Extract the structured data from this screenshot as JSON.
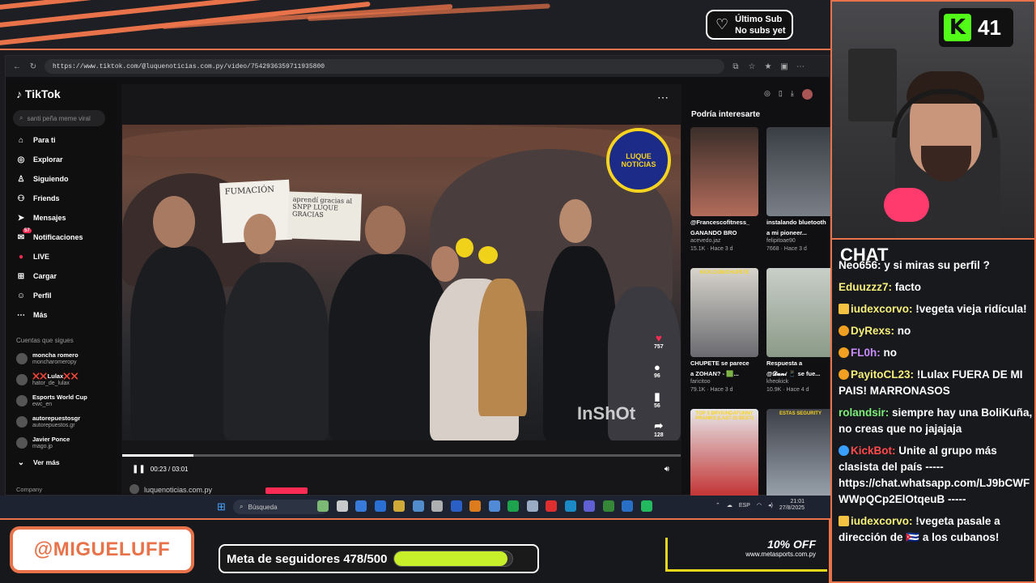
{
  "colors": {
    "accent": "#e8734a",
    "kick_green": "#53fc18",
    "goal_fill": "#c8f02a",
    "tiktok_red": "#fe2c55"
  },
  "overlay": {
    "sub_title": "Último Sub",
    "sub_value": "No subs yet",
    "kick_count": "41",
    "handle": "@MIGUELUFF",
    "goal_text": "Meta de seguidores 478/500",
    "goal_progress": 0.956,
    "ad_headline": "10% OFF",
    "ad_site": "www.metasports.com.py"
  },
  "browser": {
    "url": "https://www.tiktok.com/@luquenoticias.com.py/video/7542936359711935800"
  },
  "tiktok": {
    "logo": "TikTok",
    "search_placeholder": "santi peña meme viral",
    "nav": [
      {
        "label": "Para ti",
        "icon": "home-icon"
      },
      {
        "label": "Explorar",
        "icon": "compass-icon"
      },
      {
        "label": "Siguiendo",
        "icon": "following-icon"
      },
      {
        "label": "Friends",
        "icon": "friends-icon"
      },
      {
        "label": "Mensajes",
        "icon": "send-icon"
      },
      {
        "label": "Notificaciones",
        "icon": "inbox-icon",
        "badge": "57"
      },
      {
        "label": "LIVE",
        "icon": "live-icon"
      },
      {
        "label": "Cargar",
        "icon": "plus-icon"
      },
      {
        "label": "Perfil",
        "icon": "profile-icon"
      },
      {
        "label": "Más",
        "icon": "more-icon"
      }
    ],
    "following_title": "Cuentas que sigues",
    "following": [
      {
        "name": "moncha romero",
        "handle": "moncharomeropy"
      },
      {
        "name": "❌❌Lulax❌❌",
        "handle": "hator_de_lulax"
      },
      {
        "name": "Esports World Cup",
        "handle": "ewc_en"
      },
      {
        "name": "autorepuestosgr",
        "handle": "autorepuestos.gr"
      },
      {
        "name": "Javier Ponce",
        "handle": "mago.jp"
      }
    ],
    "see_more": "Ver más",
    "company": "Company",
    "video": {
      "logo_text": "LUQUE NOTICIAS",
      "watermark": "InShOt",
      "sign_text": "FUMACIÓN",
      "sign2_text": "aprendí gracias al SNPP LUQUE GRACIAS",
      "time": "00:23 / 03:01",
      "progress": 0.127,
      "channel": "luquenoticias.com.py"
    },
    "actions": [
      {
        "icon": "heart-icon",
        "count": "757"
      },
      {
        "icon": "comment-icon",
        "count": "96"
      },
      {
        "icon": "bookmark-icon",
        "count": "56"
      },
      {
        "icon": "share-icon",
        "count": "128"
      }
    ],
    "reco_title": "Podría interesarte",
    "reco": [
      {
        "caption": "@Francescofitness_",
        "caption2": "GANANDO BRO",
        "author": "acevedo.jaz",
        "stats": "15.1K · Hace 3 d"
      },
      {
        "caption": "instalando bluetooth",
        "caption2": "a mi pioneer...",
        "author": "felipitoae90",
        "stats": "7668 · Hace 3 d"
      },
      {
        "caption": "CHUPETE se parece",
        "caption2": "a ZOHAN? - 🟩...",
        "author": "faricitoo",
        "stats": "79.1K · Hace 3 d",
        "thumb_label": "KICK.COM/CHUPETE"
      },
      {
        "caption": "Respuesta a",
        "caption2": "@𝓓𝓪𝓷𝓲 📱 se fue...",
        "author": "kheokick",
        "stats": "10.9K · Hace 4 d"
      },
      {
        "caption": "",
        "caption2": "",
        "author": "",
        "stats": "",
        "thumb_label": "TOP 5 BRYKINDAFUNNY PRANKS (LAST IS BEST)"
      },
      {
        "caption": "",
        "caption2": "",
        "author": "",
        "stats": "",
        "thumb_label": "ESTAS SEGURITY"
      }
    ]
  },
  "taskbar": {
    "search_placeholder": "Búsqueda",
    "lang": "ESP",
    "time": "21:01",
    "date": "27/8/2025"
  },
  "chat": {
    "title": "CHAT",
    "messages": [
      {
        "user": "Neo656",
        "user_color": "#fff",
        "text": "y si miras su perfil ?"
      },
      {
        "user": "Eduuzzz7",
        "user_color": "#f6f07a",
        "text": "facto"
      },
      {
        "user": "iudexcorvo",
        "user_color": "#f6f07a",
        "text": "!vegeta vieja ridícula!",
        "badge": "crown"
      },
      {
        "user": "DyRexs",
        "user_color": "#f6f07a",
        "text": "no",
        "badge": "coin"
      },
      {
        "user": "FL0h",
        "user_color": "#c98cff",
        "text": "no",
        "badge": "coin"
      },
      {
        "user": "PayitoCL23",
        "user_color": "#f6f07a",
        "text": "!Lulax FUERA DE MI PAIS! MARRONASOS",
        "badge": "coin"
      },
      {
        "user": "rolandsir",
        "user_color": "#7df07a",
        "text": "siempre hay una BoliKuña, no creas que no jajajaja"
      },
      {
        "user": "KickBot",
        "user_color": "#ff4a4a",
        "text": "Unite al grupo más clasista del país ----- https://chat.whatsapp.com/LJ9bCWFWWpQCp2ElOtqeuB -----",
        "badge": "bot"
      },
      {
        "user": "iudexcorvo",
        "user_color": "#f6f07a",
        "text": "!vegeta pasale a dirección de 🇨🇺 a los cubanos!",
        "badge": "crown"
      }
    ]
  }
}
